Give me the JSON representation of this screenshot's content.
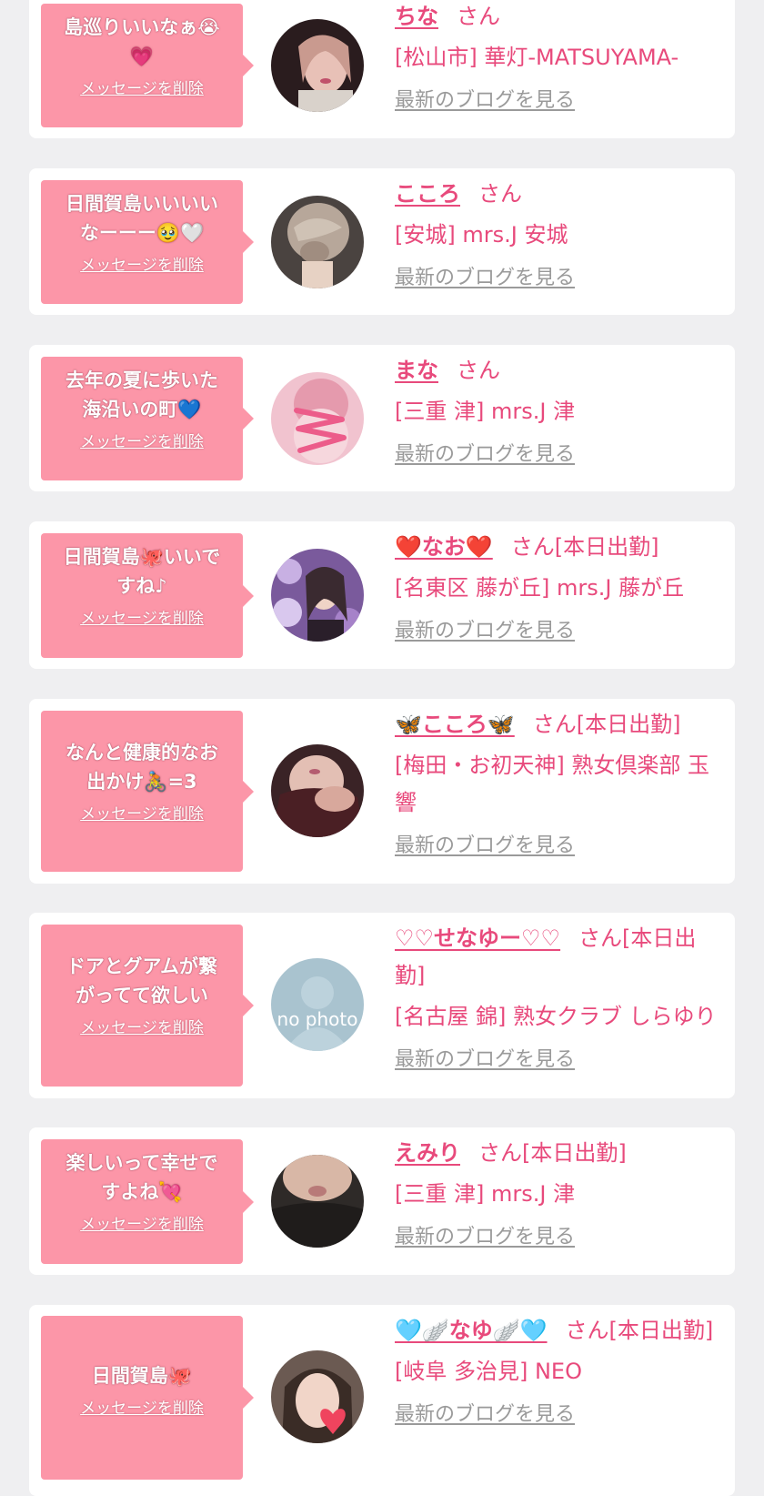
{
  "delete_label": "メッセージを削除",
  "blog_label": "最新のブログを見る",
  "colors": {
    "accent": "#e84a7c",
    "bubble": "#fc96a8",
    "background": "#efeff1",
    "card": "#ffffff",
    "link_gray": "#9a9a9a"
  },
  "cards": [
    {
      "message_lines": [
        "島巡りいいなぁ😭",
        "💗"
      ],
      "name": "ちな",
      "suffix": "さん",
      "shop": "[松山市] 華灯-MATSUYAMA-",
      "avatar": "portrait-photo"
    },
    {
      "message_lines": [
        "日間賀島いいいい",
        "なーーー🥹🤍"
      ],
      "name": "こころ",
      "suffix": "さん",
      "shop": "[安城] mrs.J 安城",
      "avatar": "hair-back-photo"
    },
    {
      "message_lines": [
        "去年の夏に歩いた",
        "海沿いの町💙"
      ],
      "name": "まな",
      "suffix": "さん",
      "shop": "[三重 津] mrs.J 津",
      "avatar": "scribbled-pink-photo"
    },
    {
      "message_lines": [
        "日間賀島🐙いいで",
        "すね♪"
      ],
      "name": "❤️なお❤️",
      "suffix": "さん[本日出勤]",
      "shop": "[名東区 藤が丘] mrs.J 藤が丘",
      "avatar": "flower-portrait-photo"
    },
    {
      "message_lines": [
        "なんと健康的なお",
        "出かけ🚴=3"
      ],
      "name": "🦋こころ🦋",
      "suffix": "さん[本日出勤]",
      "shop": "[梅田・お初天神] 熟女倶楽部 玉響",
      "avatar": "shoulder-photo"
    },
    {
      "message_lines": [
        "ドアとグアムが繋",
        "がってて欲しい"
      ],
      "name": "♡♡せなゆー♡♡",
      "suffix": "さん[本日出勤]",
      "shop": "[名古屋 錦] 熟女クラブ しらゆり",
      "avatar": "no-photo",
      "avatar_text": "no photo"
    },
    {
      "message_lines": [
        "楽しいって幸せで",
        "すよね💘"
      ],
      "name": "えみり",
      "suffix": "さん[本日出勤]",
      "shop": "[三重 津] mrs.J 津",
      "avatar": "face-closeup-photo"
    },
    {
      "message_lines": [
        "日間賀島🐙"
      ],
      "name": "🩵🪽なゆ🪽🩵",
      "suffix": "さん[本日出勤]",
      "shop": "[岐阜 多治見] NEO",
      "avatar": "heart-covered-photo"
    }
  ]
}
